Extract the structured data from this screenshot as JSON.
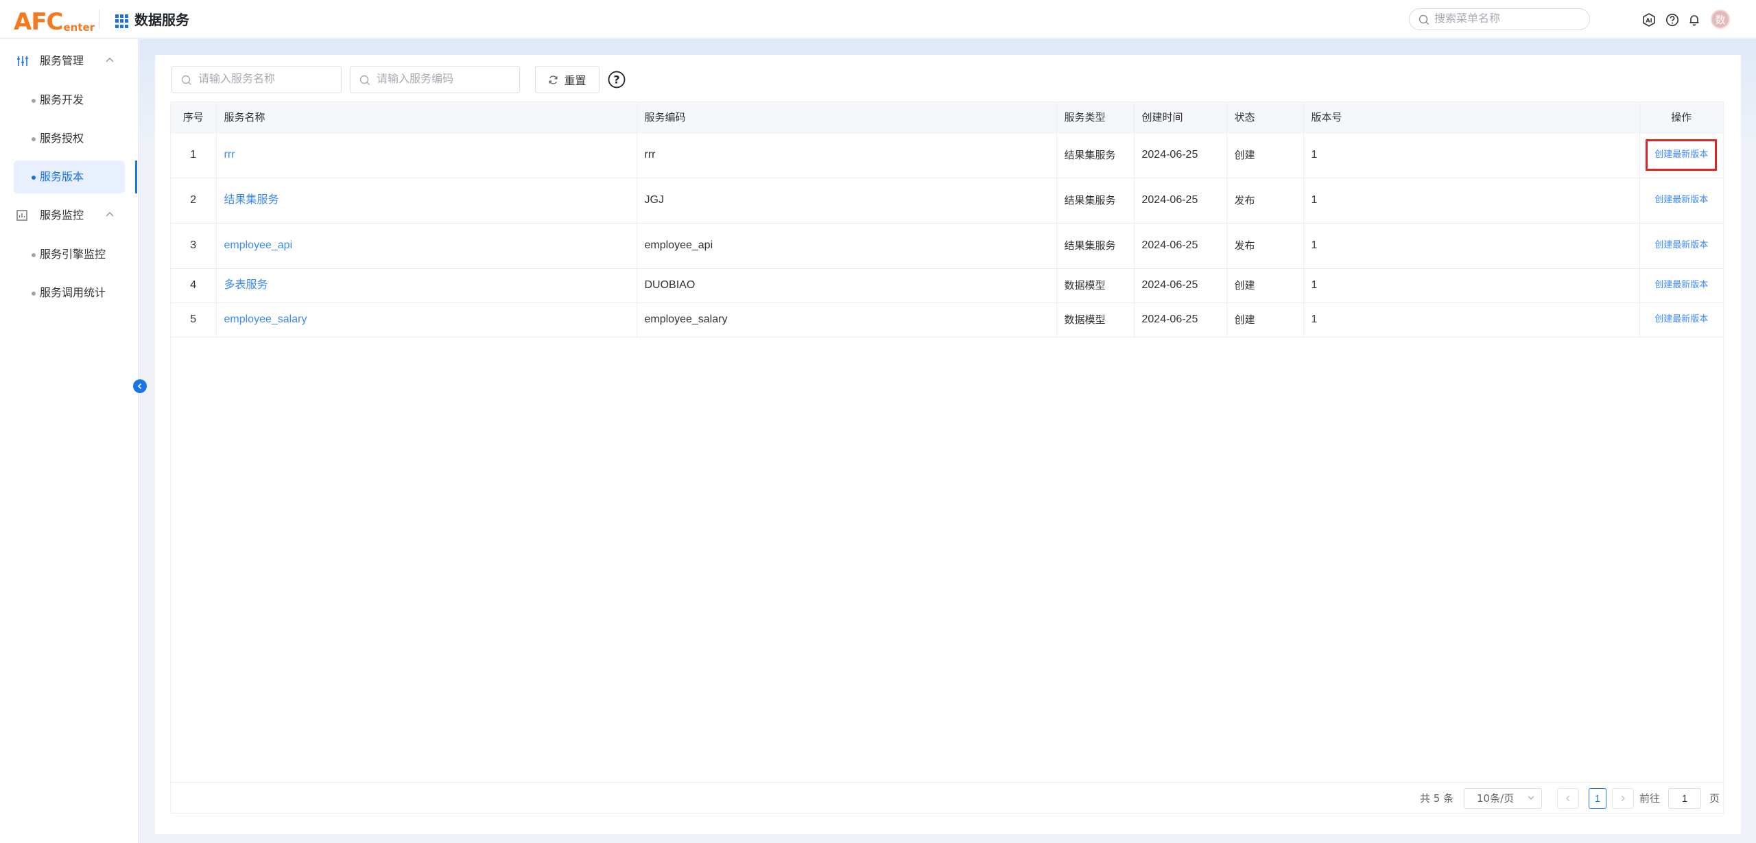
{
  "header": {
    "logo_main": "AFC",
    "logo_sub": "enter",
    "app_title": "数据服务",
    "search_placeholder": "搜索菜单名称",
    "avatar_text": "数",
    "ai_icon_label": "AI"
  },
  "sidebar": {
    "groups": [
      {
        "label": "服务管理",
        "items": [
          "服务开发",
          "服务授权",
          "服务版本"
        ]
      },
      {
        "label": "服务监控",
        "items": [
          "服务引擎监控",
          "服务调用统计"
        ]
      }
    ],
    "active_item": "服务版本"
  },
  "filters": {
    "name_placeholder": "请输入服务名称",
    "code_placeholder": "请输入服务编码",
    "reset_label": "重置",
    "help_glyph": "?"
  },
  "table": {
    "columns": [
      "序号",
      "服务名称",
      "服务编码",
      "服务类型",
      "创建时间",
      "状态",
      "版本号",
      "操作"
    ],
    "rows": [
      {
        "index": "1",
        "name": "rrr",
        "code": "rrr",
        "type": "结果集服务",
        "created": "2024-06-25",
        "status": "创建",
        "version": "1",
        "action": "创建最新版本"
      },
      {
        "index": "2",
        "name": "结果集服务",
        "code": "JGJ",
        "type": "结果集服务",
        "created": "2024-06-25",
        "status": "发布",
        "version": "1",
        "action": "创建最新版本"
      },
      {
        "index": "3",
        "name": "employee_api",
        "code": "employee_api",
        "type": "结果集服务",
        "created": "2024-06-25",
        "status": "发布",
        "version": "1",
        "action": "创建最新版本"
      },
      {
        "index": "4",
        "name": "多表服务",
        "code": "DUOBIAO",
        "type": "数据模型",
        "created": "2024-06-25",
        "status": "创建",
        "version": "1",
        "action": "创建最新版本"
      },
      {
        "index": "5",
        "name": "employee_salary",
        "code": "employee_salary",
        "type": "数据模型",
        "created": "2024-06-25",
        "status": "创建",
        "version": "1",
        "action": "创建最新版本"
      }
    ]
  },
  "pagination": {
    "total_text": "共 5 条",
    "page_size": "10条/页",
    "current_page": "1",
    "goto_label": "前往",
    "goto_value": "1",
    "page_suffix": "页"
  },
  "colors": {
    "brand": "#f47a1f",
    "accent": "#1a73e8",
    "link": "#3d8af7",
    "highlight": "#e02424"
  }
}
